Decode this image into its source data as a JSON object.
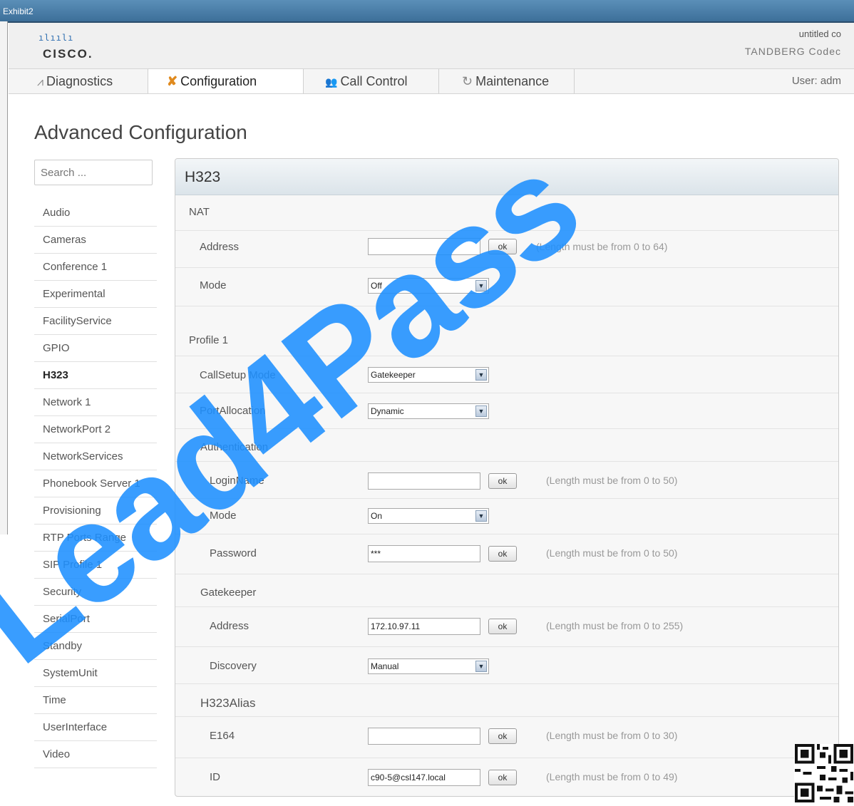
{
  "window": {
    "title": "Exhibit2"
  },
  "header": {
    "logo_bars": "ılıılı",
    "logo_text": "CISCO.",
    "system_name": "untitled co",
    "product": "TANDBERG Codec"
  },
  "nav": {
    "items": [
      {
        "label": "Diagnostics",
        "icon": "pulse-icon"
      },
      {
        "label": "Configuration",
        "icon": "wrench-icon"
      },
      {
        "label": "Call Control",
        "icon": "people-icon"
      },
      {
        "label": "Maintenance",
        "icon": "refresh-icon"
      }
    ],
    "active": "Configuration",
    "user": "User: adm"
  },
  "page": {
    "title": "Advanced Configuration"
  },
  "search": {
    "placeholder": "Search ..."
  },
  "sidebar": {
    "items": [
      "Audio",
      "Cameras",
      "Conference 1",
      "Experimental",
      "FacilityService",
      "GPIO",
      "H323",
      "Network 1",
      "NetworkPort 2",
      "NetworkServices",
      "Phonebook Server 1",
      "Provisioning",
      "RTP Ports Range",
      "SIP Profile 1",
      "Security",
      "SerialPort",
      "Standby",
      "SystemUnit",
      "Time",
      "UserInterface",
      "Video"
    ],
    "active": "H323"
  },
  "panel": {
    "title": "H323",
    "nat": {
      "heading": "NAT",
      "address_label": "Address",
      "address_value": "",
      "address_hint": "(Length must be from 0 to 64)",
      "mode_label": "Mode",
      "mode_value": "Off"
    },
    "profile": {
      "heading": "Profile 1",
      "callsetup_label": "CallSetup Mode",
      "callsetup_value": "Gatekeeper",
      "portalloc_label": "PortAllocation",
      "portalloc_value": "Dynamic",
      "auth": {
        "heading": "Authentication",
        "login_label": "LoginName",
        "login_value": "",
        "login_hint": "(Length must be from 0 to 50)",
        "mode_label": "Mode",
        "mode_value": "On",
        "password_label": "Password",
        "password_value": "***",
        "password_hint": "(Length must be from 0 to 50)"
      },
      "gatekeeper": {
        "heading": "Gatekeeper",
        "address_label": "Address",
        "address_value": "172.10.97.11",
        "address_hint": "(Length must be from 0 to 255)",
        "discovery_label": "Discovery",
        "discovery_value": "Manual"
      },
      "alias": {
        "heading": "H323Alias",
        "e164_label": "E164",
        "e164_value": "",
        "e164_hint": "(Length must be from 0 to 30)",
        "id_label": "ID",
        "id_value": "c90-5@csl147.local",
        "id_hint": "(Length must be from 0 to 49)"
      }
    },
    "ok_label": "ok"
  },
  "watermark": {
    "text": "Lead4Pass"
  },
  "colors": {
    "watermark": "#1e90ff",
    "accent": "#2f6fb1",
    "titlebar": "#3d6f99"
  }
}
